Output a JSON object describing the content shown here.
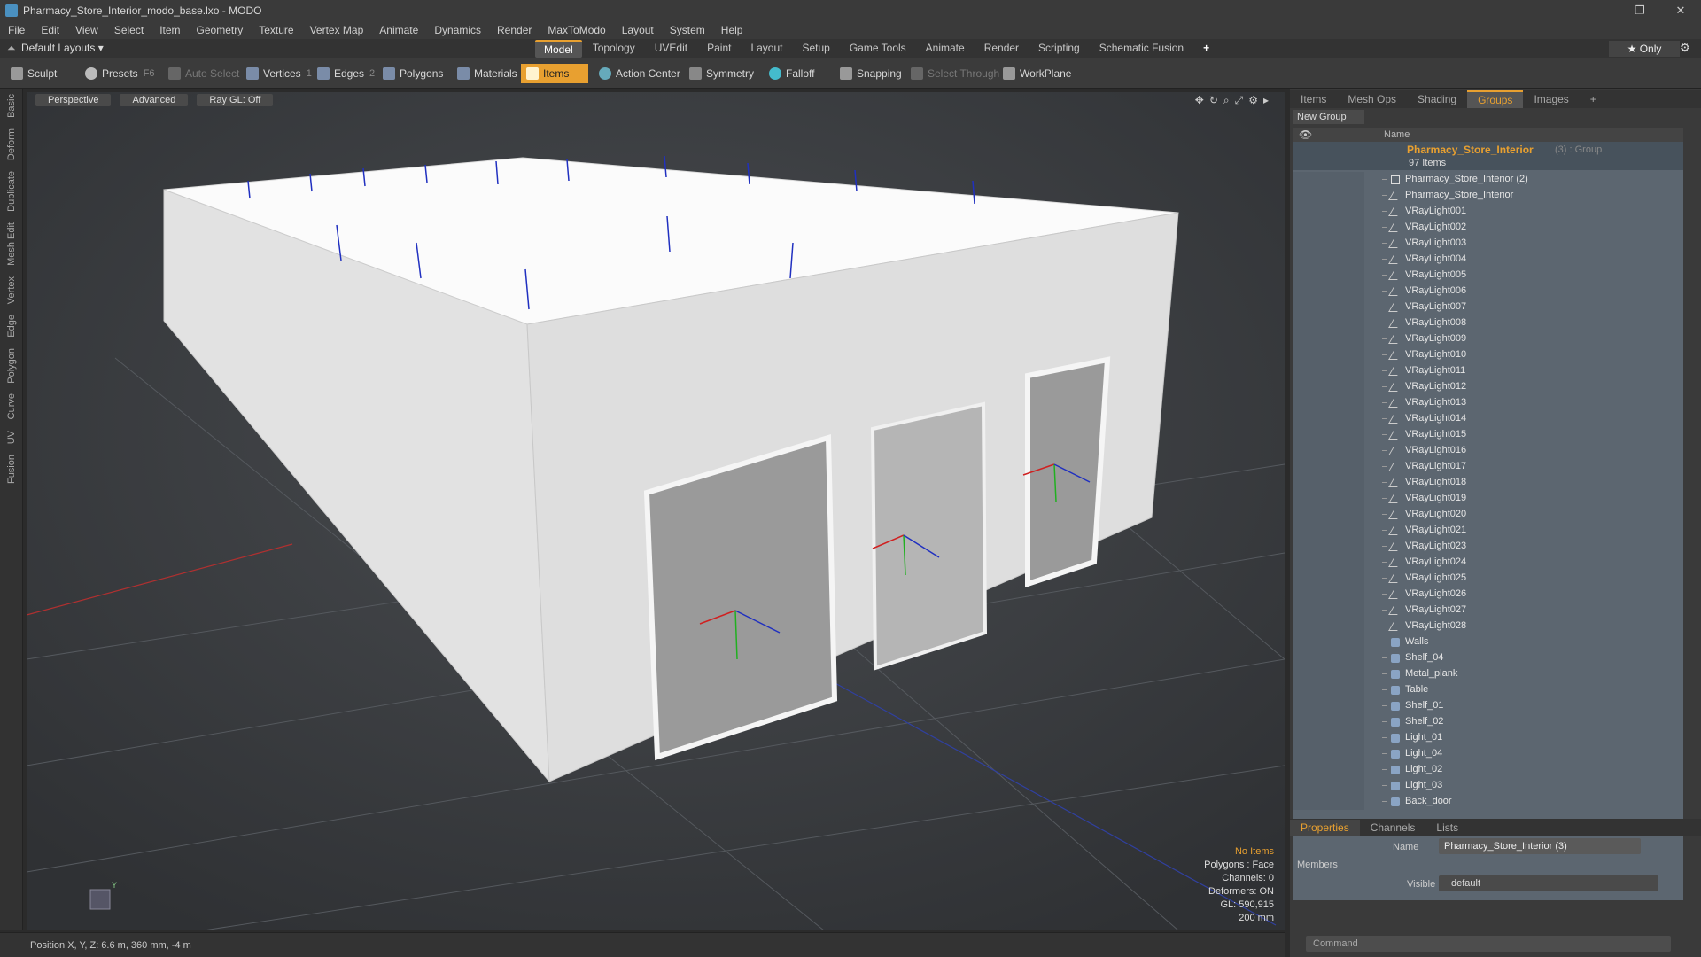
{
  "window": {
    "title": "Pharmacy_Store_Interior_modo_base.lxo - MODO",
    "controls": [
      "—",
      "❐",
      "✕"
    ]
  },
  "menu": [
    "File",
    "Edit",
    "View",
    "Select",
    "Item",
    "Geometry",
    "Texture",
    "Vertex Map",
    "Animate",
    "Dynamics",
    "Render",
    "MaxToModo",
    "Layout",
    "System",
    "Help"
  ],
  "layout": {
    "selector": "Default Layouts ▾",
    "tabs": [
      "Model",
      "Topology",
      "UVEdit",
      "Paint",
      "Layout",
      "Setup",
      "Game Tools",
      "Animate",
      "Render",
      "Scripting",
      "Schematic Fusion"
    ],
    "active_tab": "Model",
    "only": "★ Only"
  },
  "toolbar": {
    "sculpt": "Sculpt",
    "presets": "Presets",
    "presets_key": "F6",
    "auto_select": "Auto Select",
    "vertices": "Vertices",
    "vertices_key": "1",
    "edges": "Edges",
    "edges_key": "2",
    "polygons": "Polygons",
    "materials": "Materials",
    "items": "Items",
    "action_center": "Action Center",
    "symmetry": "Symmetry",
    "falloff": "Falloff",
    "snapping": "Snapping",
    "select_through": "Select Through",
    "workplane": "WorkPlane"
  },
  "left_tabs": [
    "Basic",
    "Deform",
    "Duplicate",
    "Mesh Edit",
    "Vertex",
    "Edge",
    "Polygon",
    "Curve",
    "UV",
    "Fusion"
  ],
  "viewport": {
    "view": "Perspective",
    "shading": "Advanced",
    "raygl": "Ray GL: Off",
    "info": {
      "items": "No Items",
      "polygons": "Polygons : Face",
      "channels": "Channels: 0",
      "deformers": "Deformers: ON",
      "gl": "GL: 590,915",
      "grid": "200 mm"
    }
  },
  "status": {
    "position": "Position X, Y, Z:   6.6 m, 360 mm, -4 m"
  },
  "right_panel": {
    "tabs": [
      "Items",
      "Mesh Ops",
      "Shading",
      "Groups",
      "Images"
    ],
    "active_tab": "Groups",
    "new_group": "New Group",
    "name_col": "Name",
    "group": {
      "name": "Pharmacy_Store_Interior",
      "suffix": "(3) : Group",
      "count": "97 Items"
    },
    "items": [
      {
        "label": "Pharmacy_Store_Interior (2)",
        "type": "grp"
      },
      {
        "label": "Pharmacy_Store_Interior",
        "type": "light"
      },
      {
        "label": "VRayLight001",
        "type": "light"
      },
      {
        "label": "VRayLight002",
        "type": "light"
      },
      {
        "label": "VRayLight003",
        "type": "light"
      },
      {
        "label": "VRayLight004",
        "type": "light"
      },
      {
        "label": "VRayLight005",
        "type": "light"
      },
      {
        "label": "VRayLight006",
        "type": "light"
      },
      {
        "label": "VRayLight007",
        "type": "light"
      },
      {
        "label": "VRayLight008",
        "type": "light"
      },
      {
        "label": "VRayLight009",
        "type": "light"
      },
      {
        "label": "VRayLight010",
        "type": "light"
      },
      {
        "label": "VRayLight011",
        "type": "light"
      },
      {
        "label": "VRayLight012",
        "type": "light"
      },
      {
        "label": "VRayLight013",
        "type": "light"
      },
      {
        "label": "VRayLight014",
        "type": "light"
      },
      {
        "label": "VRayLight015",
        "type": "light"
      },
      {
        "label": "VRayLight016",
        "type": "light"
      },
      {
        "label": "VRayLight017",
        "type": "light"
      },
      {
        "label": "VRayLight018",
        "type": "light"
      },
      {
        "label": "VRayLight019",
        "type": "light"
      },
      {
        "label": "VRayLight020",
        "type": "light"
      },
      {
        "label": "VRayLight021",
        "type": "light"
      },
      {
        "label": "VRayLight023",
        "type": "light"
      },
      {
        "label": "VRayLight024",
        "type": "light"
      },
      {
        "label": "VRayLight025",
        "type": "light"
      },
      {
        "label": "VRayLight026",
        "type": "light"
      },
      {
        "label": "VRayLight027",
        "type": "light"
      },
      {
        "label": "VRayLight028",
        "type": "light"
      },
      {
        "label": "Walls",
        "type": "mesh"
      },
      {
        "label": "Shelf_04",
        "type": "mesh"
      },
      {
        "label": "Metal_plank",
        "type": "mesh"
      },
      {
        "label": "Table",
        "type": "mesh"
      },
      {
        "label": "Shelf_01",
        "type": "mesh"
      },
      {
        "label": "Shelf_02",
        "type": "mesh"
      },
      {
        "label": "Light_01",
        "type": "mesh"
      },
      {
        "label": "Light_04",
        "type": "mesh"
      },
      {
        "label": "Light_02",
        "type": "mesh"
      },
      {
        "label": "Light_03",
        "type": "mesh"
      },
      {
        "label": "Back_door",
        "type": "mesh"
      }
    ],
    "properties": {
      "tabs": [
        "Properties",
        "Channels",
        "Lists"
      ],
      "name_label": "Name",
      "name_value": "Pharmacy_Store_Interior (3)",
      "members": "Members",
      "visible_label": "Visible",
      "visible_value": "default"
    },
    "command_placeholder": "Command"
  }
}
